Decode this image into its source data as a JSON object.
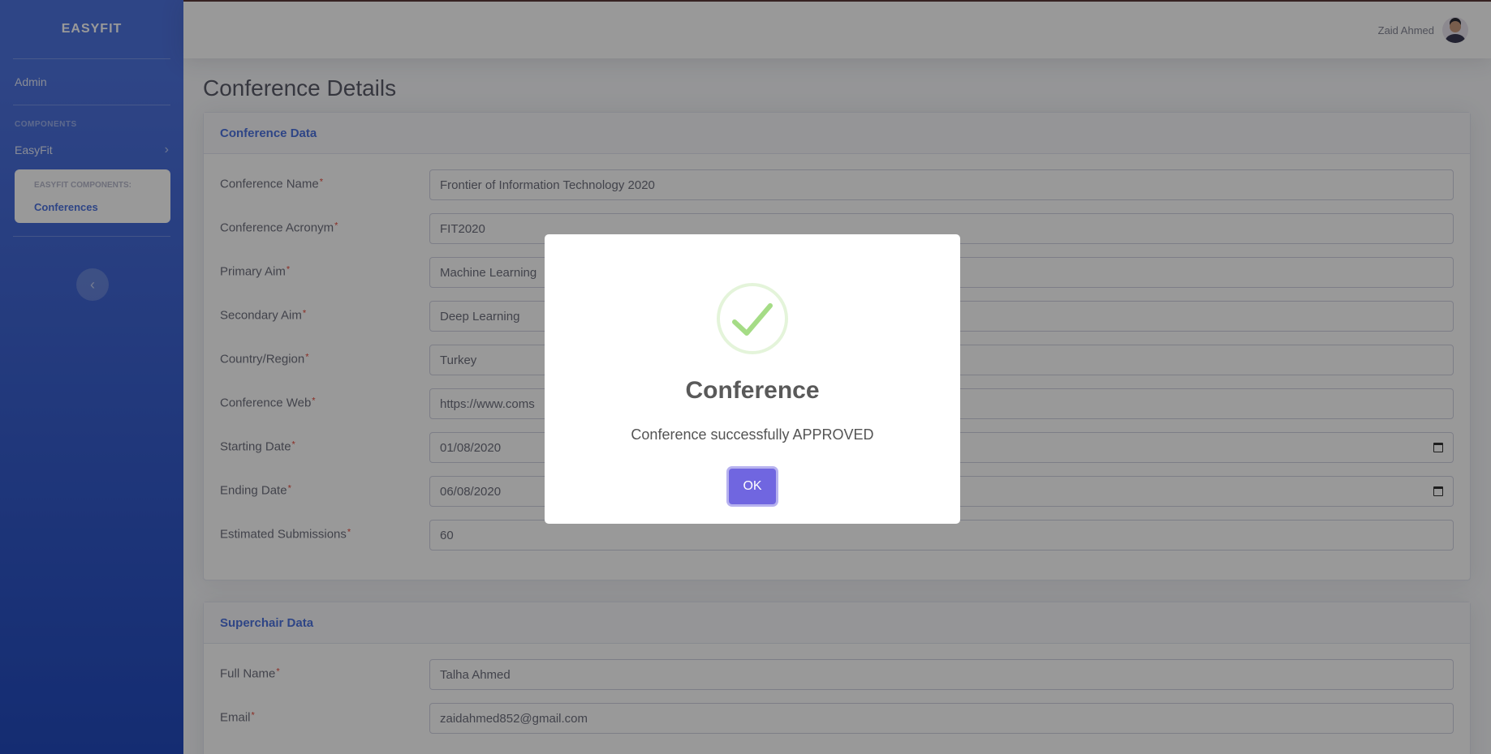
{
  "sidebar": {
    "brand": "EASYFIT",
    "admin_link": "Admin",
    "section_heading": "COMPONENTS",
    "nav_item": "EasyFit",
    "collapse_header": "EASYFIT COMPONENTS:",
    "collapse_item": "Conferences"
  },
  "topbar": {
    "user_name": "Zaid Ahmed"
  },
  "page": {
    "title": "Conference Details"
  },
  "conference_card": {
    "header": "Conference Data",
    "fields": [
      {
        "label": "Conference Name",
        "value": "Frontier of Information Technology 2020"
      },
      {
        "label": "Conference Acronym",
        "value": "FIT2020"
      },
      {
        "label": "Primary Aim",
        "value": "Machine Learning"
      },
      {
        "label": "Secondary Aim",
        "value": "Deep Learning"
      },
      {
        "label": "Country/Region",
        "value": "Turkey"
      },
      {
        "label": "Conference Web",
        "value": "https://www.coms"
      },
      {
        "label": "Starting Date",
        "value": "01/08/2020"
      },
      {
        "label": "Ending Date",
        "value": "06/08/2020"
      },
      {
        "label": "Estimated Submissions",
        "value": "60"
      }
    ]
  },
  "superchair_card": {
    "header": "Superchair Data",
    "fields": [
      {
        "label": "Full Name",
        "value": "Talha Ahmed"
      },
      {
        "label": "Email",
        "value": "zaidahmed852@gmail.com"
      }
    ]
  },
  "required_marker": "*",
  "modal": {
    "title": "Conference",
    "message": "Conference successfully APPROVED",
    "ok_label": "OK"
  }
}
